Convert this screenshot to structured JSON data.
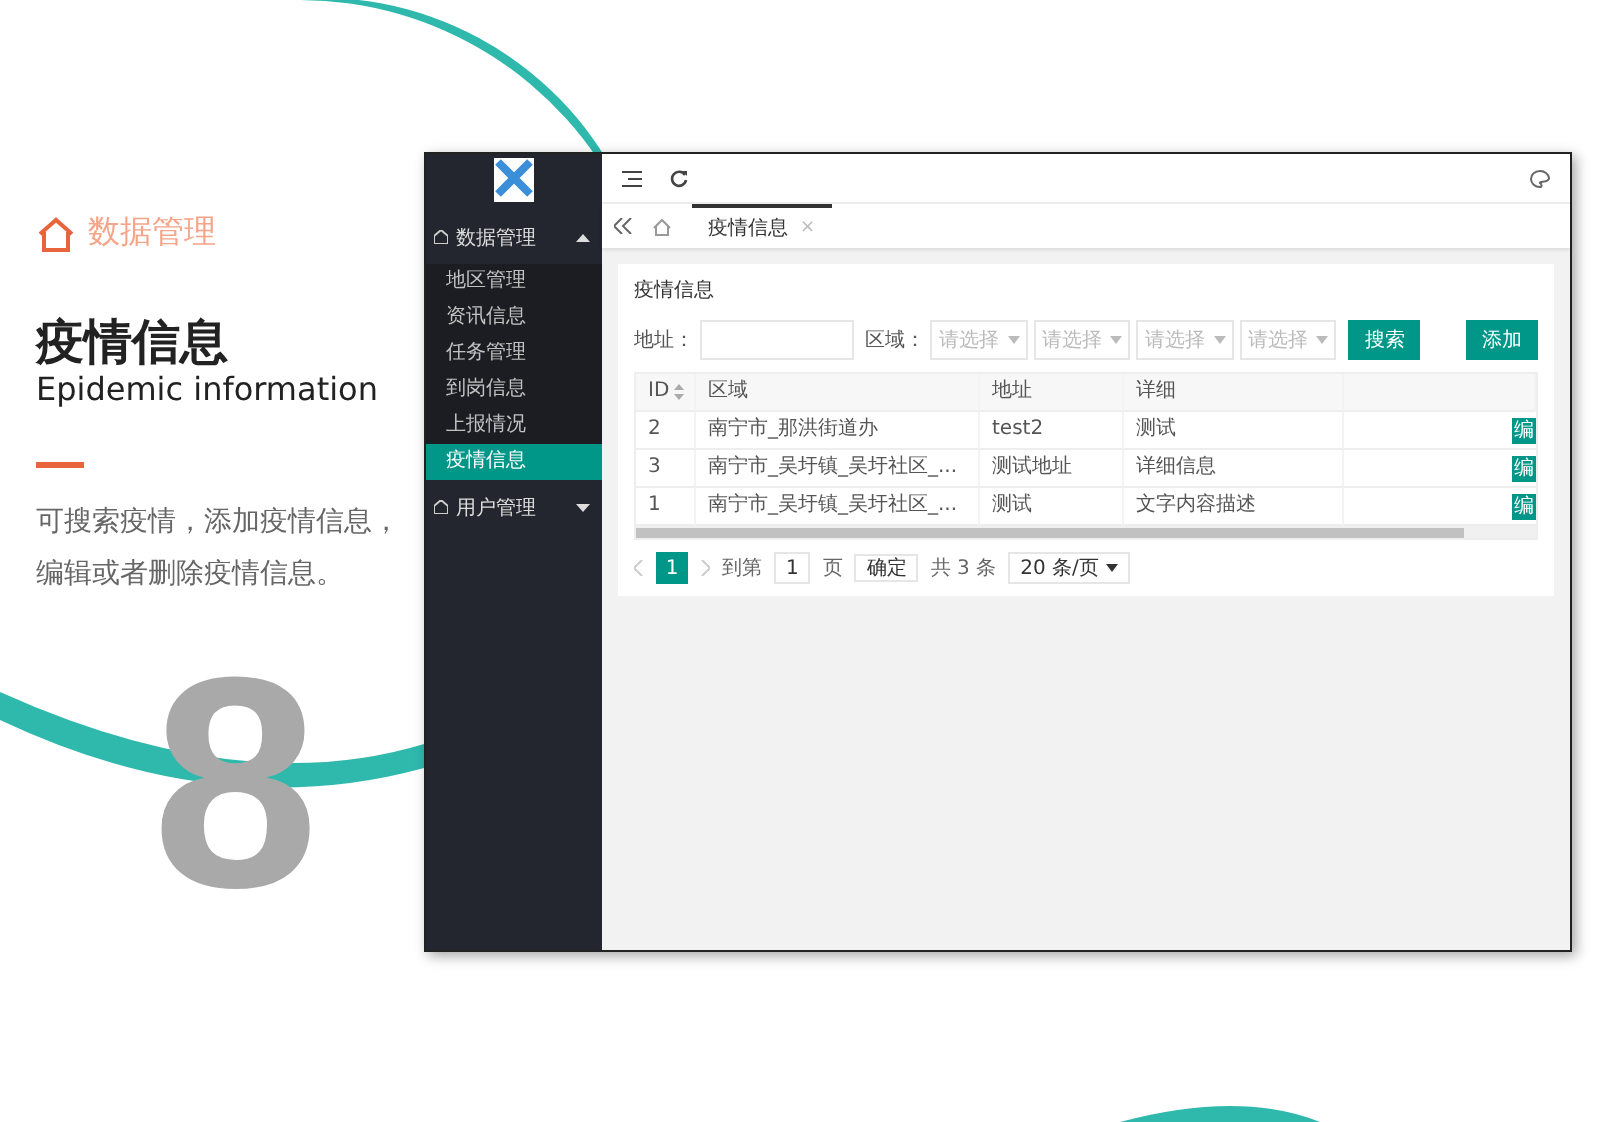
{
  "slide": {
    "section": "数据管理",
    "title": "疫情信息",
    "subtitle": "Epidemic information",
    "description": "可搜索疫情，添加疫情信息，编辑或者删除疫情信息。",
    "step_number": "8"
  },
  "sidebar": {
    "groups": [
      {
        "label": "数据管理",
        "expanded": true,
        "items": [
          {
            "label": "地区管理",
            "selected": false
          },
          {
            "label": "资讯信息",
            "selected": false
          },
          {
            "label": "任务管理",
            "selected": false
          },
          {
            "label": "到岗信息",
            "selected": false
          },
          {
            "label": "上报情况",
            "selected": false
          },
          {
            "label": "疫情信息",
            "selected": true
          }
        ]
      },
      {
        "label": "用户管理",
        "expanded": false
      }
    ]
  },
  "tabs": [
    {
      "label": "疫情信息",
      "selected": true,
      "close": "×"
    }
  ],
  "card": {
    "title": "疫情信息",
    "filters": {
      "address_label": "地址：",
      "region_label": "区域：",
      "selects": [
        "请选择",
        "请选择",
        "请选择",
        "请选择"
      ],
      "search_button": "搜索",
      "add_button": "添加"
    },
    "table": {
      "columns": [
        "ID",
        "区域",
        "地址",
        "详细"
      ],
      "rows": [
        {
          "cells": [
            "2",
            "南宁市_那洪街道办",
            "test2",
            "测试"
          ],
          "action": "编"
        },
        {
          "cells": [
            "3",
            "南宁市_吴圩镇_吴圩社区_...",
            "测试地址",
            "详细信息"
          ],
          "action": "编"
        },
        {
          "cells": [
            "1",
            "南宁市_吴圩镇_吴圩社区_...",
            "测试",
            "文字内容描述"
          ],
          "action": "编"
        }
      ]
    },
    "pagination": {
      "pages": [
        {
          "label": "1",
          "selected": true
        }
      ],
      "goto_label": "到第",
      "goto_value": "1",
      "page_unit": "页",
      "confirm": "确定",
      "total": "共 3 条",
      "page_size": "20 条/页"
    }
  }
}
